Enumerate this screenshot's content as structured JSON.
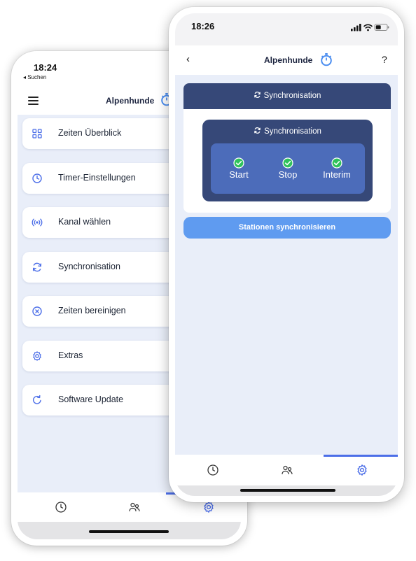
{
  "back_screen": {
    "status_time": "18:24",
    "back_link": "◂ Suchen",
    "header_title": "Alpenhunde",
    "menu": [
      {
        "label": "Zeiten Überblick",
        "icon": "grid-icon"
      },
      {
        "label": "Timer-Einstellungen",
        "icon": "clock-icon"
      },
      {
        "label": "Kanal wählen",
        "icon": "radio-signal-icon"
      },
      {
        "label": "Synchronisation",
        "icon": "sync-icon"
      },
      {
        "label": "Zeiten bereinigen",
        "icon": "clear-circle-icon"
      },
      {
        "label": "Extras",
        "icon": "gear-icon"
      },
      {
        "label": "Software Update",
        "icon": "refresh-icon"
      }
    ],
    "tabs": [
      {
        "icon": "clock-icon"
      },
      {
        "icon": "people-icon"
      },
      {
        "icon": "settings-icon",
        "active": true
      }
    ]
  },
  "front_screen": {
    "status_time": "18:26",
    "header_title": "Alpenhunde",
    "help_label": "?",
    "back_label": "‹",
    "card_title": "Synchronisation",
    "inner_title": "Synchronisation",
    "sync_states": [
      {
        "label": "Start",
        "status": "ok"
      },
      {
        "label": "Stop",
        "status": "ok"
      },
      {
        "label": "Interim",
        "status": "ok"
      }
    ],
    "sync_button_label": "Stationen synchronisieren",
    "tabs": [
      {
        "icon": "clock-icon"
      },
      {
        "icon": "people-icon"
      },
      {
        "icon": "settings-icon",
        "active": true
      }
    ]
  },
  "colors": {
    "accent": "#4c6ee8",
    "navy": "#364878",
    "panel_blue": "#4c6cba",
    "button_blue": "#5f9bf0",
    "background": "#e9eef9",
    "check_green": "#2fc25b"
  }
}
